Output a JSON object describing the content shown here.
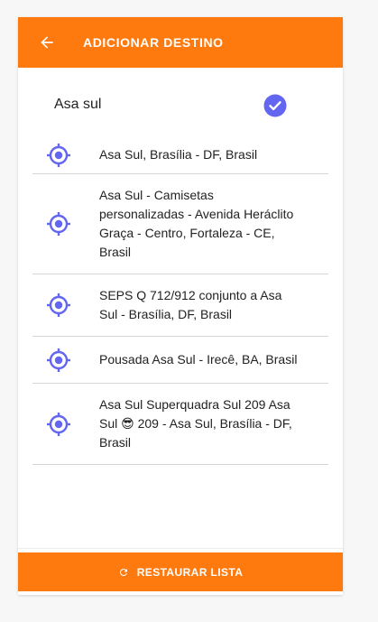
{
  "header": {
    "title": "ADICIONAR DESTINO",
    "back_icon": "arrow-left-icon",
    "background": "#ff7a0e"
  },
  "search": {
    "value": "Asa sul",
    "confirm_icon": "check-circle-icon",
    "confirm_color": "#6366f1"
  },
  "results": [
    {
      "icon": "location-target-icon",
      "label": "Asa Sul, Brasília - DF, Brasil"
    },
    {
      "icon": "location-target-icon",
      "label": "Asa Sul - Camisetas personalizadas - Avenida Heráclito Graça - Centro, Fortaleza - CE, Brasil"
    },
    {
      "icon": "location-target-icon",
      "label": "SEPS Q 712/912 conjunto a Asa Sul - Brasília, DF, Brasil"
    },
    {
      "icon": "location-target-icon",
      "label": "Pousada Asa Sul - Irecê, BA, Brasil"
    },
    {
      "icon": "location-target-icon",
      "label": "Asa Sul Superquadra Sul 209 Asa Sul 😎 209 - Asa Sul, Brasília - DF, Brasil"
    }
  ],
  "footer": {
    "restore_label": "RESTAURAR LISTA",
    "restore_icon": "refresh-icon",
    "background": "#ff7a0e"
  },
  "colors": {
    "accent": "#ff7a0e",
    "icon_blue": "#6366f1",
    "divider": "#d6d6d6"
  }
}
